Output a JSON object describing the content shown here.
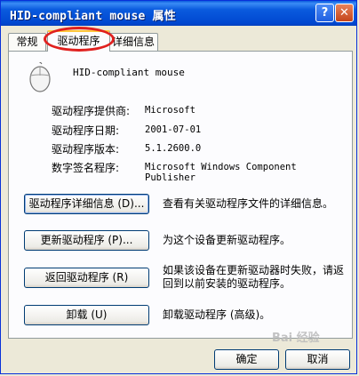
{
  "window": {
    "title": "HID-compliant mouse 属性",
    "help_label": "?",
    "close_label": "✕"
  },
  "tabs": [
    {
      "label": "常规",
      "active": false
    },
    {
      "label": "驱动程序",
      "active": true
    },
    {
      "label": "详细信息",
      "active": false
    }
  ],
  "device": {
    "icon": "mouse-icon",
    "name": "HID-compliant mouse"
  },
  "info": [
    {
      "label": "驱动程序提供商:",
      "value": "Microsoft"
    },
    {
      "label": "驱动程序日期:",
      "value": "2001-07-01"
    },
    {
      "label": "驱动程序版本:",
      "value": "5.1.2600.0"
    },
    {
      "label": "数字签名程序:",
      "value": "Microsoft Windows Component Publisher"
    }
  ],
  "actions": [
    {
      "button": "驱动程序详细信息 (D)...",
      "description": "查看有关驱动程序文件的详细信息。"
    },
    {
      "button": "更新驱动程序 (P)...",
      "description": "为这个设备更新驱动程序。"
    },
    {
      "button": "返回驱动程序 (R)",
      "description": "如果该设备在更新驱动器时失败，请返回到以前安装的驱动程序。"
    },
    {
      "button": "卸载 (U)",
      "description": "卸载驱动程序 (高级)。"
    }
  ],
  "footer": {
    "ok_label": "确定",
    "cancel_label": "取消"
  },
  "watermark": "Bai 经验",
  "colors": {
    "titlebar": "#0a5bde",
    "dialog_bg": "#ece9d8",
    "highlight_ring": "#e0201e",
    "active_tab_accent": "#ffc83c"
  }
}
